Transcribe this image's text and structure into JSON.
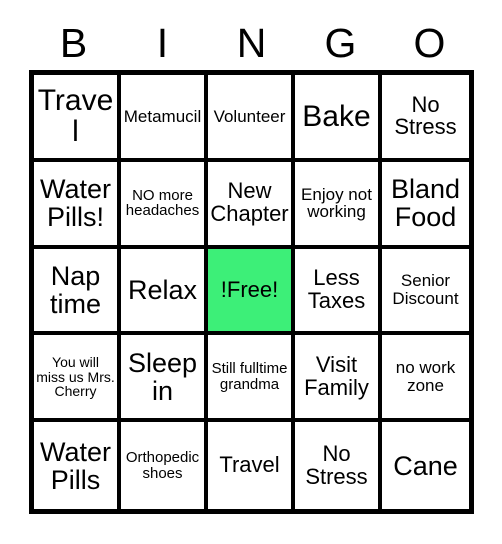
{
  "card": {
    "title_letters": [
      "B",
      "I",
      "N",
      "G",
      "O"
    ],
    "free_color": "#3DEF78",
    "border_color": "#000000",
    "background_color": "#FFFFFF",
    "rows": [
      [
        {
          "text": "Travel",
          "size": "xl",
          "free": false
        },
        {
          "text": "Metamucil",
          "size": "sm",
          "free": false
        },
        {
          "text": "Volunteer",
          "size": "sm",
          "free": false
        },
        {
          "text": "Bake",
          "size": "xl",
          "free": false
        },
        {
          "text": "No Stress",
          "size": "md",
          "free": false
        }
      ],
      [
        {
          "text": "Water Pills!",
          "size": "lg",
          "free": false
        },
        {
          "text": "NO more headaches",
          "size": "xs",
          "free": false
        },
        {
          "text": "New Chapter",
          "size": "md",
          "free": false
        },
        {
          "text": "Enjoy not working",
          "size": "sm",
          "free": false
        },
        {
          "text": "Bland Food",
          "size": "lg",
          "free": false
        }
      ],
      [
        {
          "text": "Nap time",
          "size": "lg",
          "free": false
        },
        {
          "text": "Relax",
          "size": "lg",
          "free": false
        },
        {
          "text": "!Free!",
          "size": "md",
          "free": true
        },
        {
          "text": "Less Taxes",
          "size": "md",
          "free": false
        },
        {
          "text": "Senior Discount",
          "size": "sm",
          "free": false
        }
      ],
      [
        {
          "text": "You will miss us Mrs. Cherry",
          "size": "xxs",
          "free": false
        },
        {
          "text": "Sleep in",
          "size": "lg",
          "free": false
        },
        {
          "text": "Still fulltime grandma",
          "size": "xs",
          "free": false
        },
        {
          "text": "Visit Family",
          "size": "md",
          "free": false
        },
        {
          "text": "no work zone",
          "size": "sm",
          "free": false
        }
      ],
      [
        {
          "text": "Water Pills",
          "size": "lg",
          "free": false
        },
        {
          "text": "Orthopedic shoes",
          "size": "xs",
          "free": false
        },
        {
          "text": "Travel",
          "size": "md",
          "free": false
        },
        {
          "text": "No Stress",
          "size": "md",
          "free": false
        },
        {
          "text": "Cane",
          "size": "lg",
          "free": false
        }
      ]
    ]
  }
}
